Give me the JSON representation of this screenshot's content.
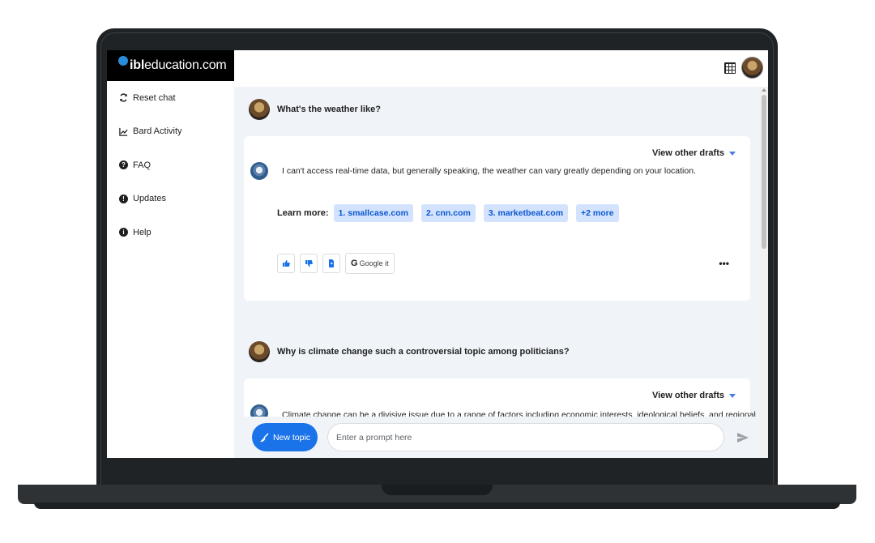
{
  "brand": {
    "prefix": "ibl",
    "suffix": "education.com"
  },
  "sidebar": {
    "items": [
      {
        "label": "Reset chat",
        "icon": "refresh-icon"
      },
      {
        "label": "Bard Activity",
        "icon": "activity-chart-icon"
      },
      {
        "label": "FAQ",
        "icon": "question-icon"
      },
      {
        "label": "Updates",
        "icon": "alert-icon"
      },
      {
        "label": "Help",
        "icon": "info-icon"
      }
    ]
  },
  "header": {
    "apps_icon": "grid-icon",
    "avatar": "user-avatar"
  },
  "conversation": [
    {
      "question": "What's the weather like?",
      "drafts_label": "View other drafts",
      "answer": "I can't access real-time data, but generally speaking, the weather can vary greatly depending on your location.",
      "learn_more_label": "Learn more:",
      "sources": [
        "1. smallcase.com",
        "2. cnn.com",
        "3. marketbeat.com",
        "+2 more"
      ],
      "google_label": "Google it",
      "more_label": "•••"
    },
    {
      "question": "Why is climate change such a controversial topic among politicians?",
      "drafts_label": "View other drafts",
      "answer": "Climate change can be a divisive issue due to a range of factors including economic interests, ideological beliefs, and regional"
    }
  ],
  "input": {
    "new_topic_label": "New topic",
    "placeholder": "Enter a prompt here"
  },
  "colors": {
    "accent": "#1a73e8",
    "chip_bg": "#d3e3fd",
    "chip_text": "#0b57d0",
    "chat_bg": "#f0f4f9"
  }
}
